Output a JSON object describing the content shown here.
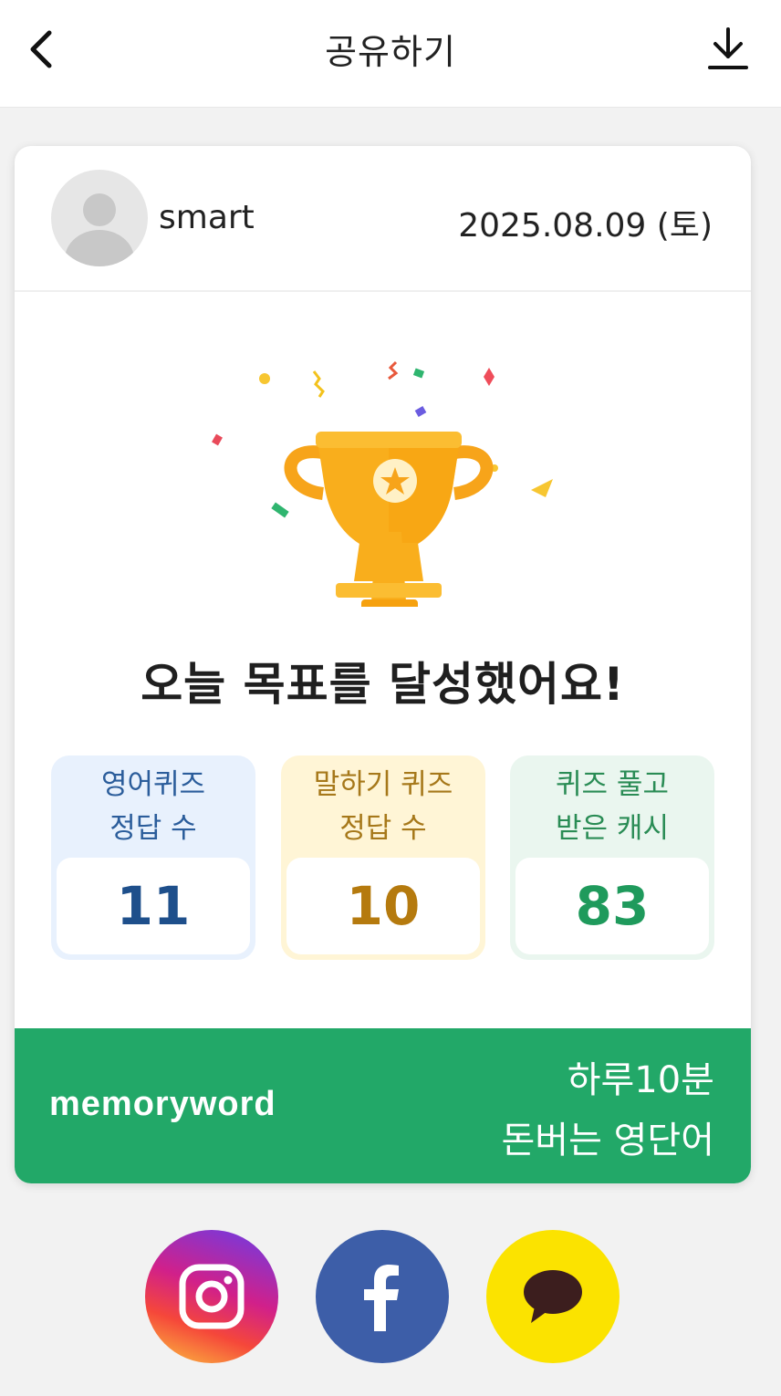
{
  "header": {
    "title": "공유하기",
    "back_icon": "chevron-left-icon",
    "download_icon": "download-icon"
  },
  "card": {
    "username": "smart",
    "date": "2025.08.09 (토)",
    "goal_message": "오늘 목표를 달성했어요!",
    "stats": [
      {
        "label_line1": "영어퀴즈",
        "label_line2": "정답 수",
        "value": "11",
        "color": "#1e4f8b"
      },
      {
        "label_line1": "말하기 퀴즈",
        "label_line2": "정답 수",
        "value": "10",
        "color": "#b57a0e"
      },
      {
        "label_line1": "퀴즈 풀고",
        "label_line2": "받은 캐시",
        "value": "83",
        "color": "#1f9a5c"
      }
    ],
    "footer": {
      "brand": "memoryword",
      "slogan_line1": "하루10분",
      "slogan_line2": "돈버는 영단어",
      "color": "#22a868"
    }
  },
  "share": {
    "buttons": [
      "instagram-icon",
      "facebook-icon",
      "kakaotalk-icon"
    ]
  }
}
